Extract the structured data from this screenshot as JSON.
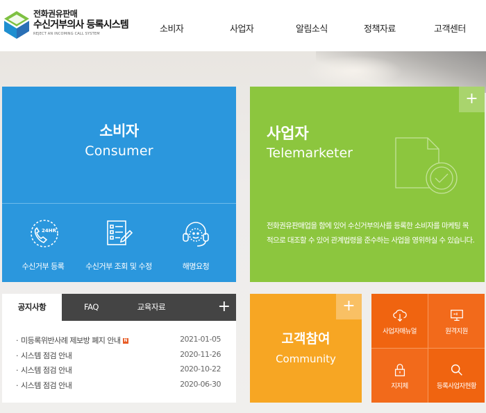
{
  "header": {
    "logo_line1": "전화권유판매",
    "logo_line2": "수신거부의사 등록시스템",
    "logo_line3": "REJECT AN INCOMING CALL SYSTEM",
    "nav": [
      "소비자",
      "사업자",
      "알림소식",
      "정책자료",
      "고객센터"
    ]
  },
  "consumer": {
    "title": "소비자",
    "subtitle": "Consumer",
    "services": [
      {
        "label": "수신거부 등록",
        "icon": "phone-24hr-icon"
      },
      {
        "label": "수신거부 조회 및 수정",
        "icon": "checklist-edit-icon"
      },
      {
        "label": "해명요청",
        "icon": "headset-icon"
      }
    ]
  },
  "business": {
    "plus": "+",
    "title": "사업자",
    "subtitle": "Telemarketer",
    "description": "전화권유판매업을 함에 있어 수신거부의사를 등록한 소비자를 마케팅 목적으로 대조할 수 있어 관계법령을 준수하는 사업을 영위하실 수 있습니다."
  },
  "notice": {
    "tabs": [
      "공지사항",
      "FAQ",
      "교육자료"
    ],
    "plus": "+",
    "new_label": "N",
    "items": [
      {
        "title": "미등록위반사례 제보방 폐지 안내",
        "date": "2021-01-05",
        "is_new": true
      },
      {
        "title": "시스템 점검 안내",
        "date": "2020-11-26",
        "is_new": false
      },
      {
        "title": "시스템 점검 안내",
        "date": "2020-10-22",
        "is_new": false
      },
      {
        "title": "시스템 점검 안내",
        "date": "2020-06-30",
        "is_new": false
      }
    ]
  },
  "community": {
    "plus": "+",
    "title": "고객참여",
    "subtitle": "Community"
  },
  "quick": [
    {
      "label": "사업자매뉴얼",
      "icon": "cloud-download-icon"
    },
    {
      "label": "원격지원",
      "icon": "monitor-icon"
    },
    {
      "label": "지지체",
      "icon": "lock-icon"
    },
    {
      "label": "등록사업자현황",
      "icon": "magnifier-icon"
    }
  ],
  "colors": {
    "consumer": "#2b97dd",
    "business": "#8cc63e",
    "community": "#f7a623",
    "quick": "#f26a1b",
    "tab_bar": "#444444"
  }
}
